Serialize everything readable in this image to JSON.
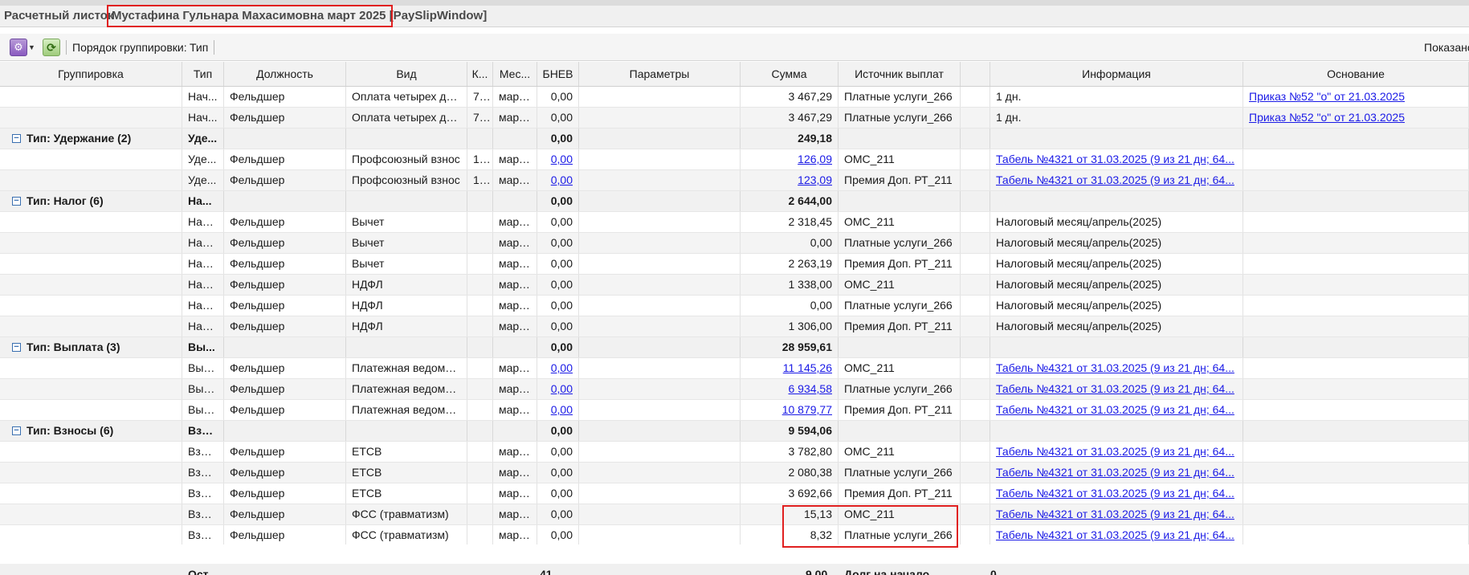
{
  "window": {
    "title_prefix": "Расчетный листок",
    "title_name": "Мустафина Гульнара Махасимовна март 2025 [PaySlipWindow]"
  },
  "toolbar": {
    "grouping_label": "Порядок группировки:",
    "grouping_value": "Тип",
    "right_label": "Показано"
  },
  "columns": [
    "Группировка",
    "Тип",
    "Должность",
    "Вид",
    "К...",
    "Мес...",
    "БНЕВ",
    "Параметры",
    "Сумма",
    "Источник выплат",
    "",
    "Информация",
    "Основание"
  ],
  "groups": [
    {
      "label": "",
      "rows": [
        {
          "type": "Нач...",
          "position": "Фельдшер",
          "kind": "Оплата четырех до...",
          "k": "7...",
          "month": "март...",
          "bnev": "0,00",
          "params": "",
          "sum": "3 467,29",
          "source": "Платные услуги_266",
          "info": "1 дн.",
          "basis": "Приказ №52 \"о\" от 21.03.2025"
        },
        {
          "type": "Нач...",
          "position": "Фельдшер",
          "kind": "Оплата четырех до...",
          "k": "7...",
          "month": "март...",
          "bnev": "0,00",
          "params": "",
          "sum": "3 467,29",
          "source": "Платные услуги_266",
          "info": "1 дн.",
          "basis": "Приказ №52 \"о\" от 21.03.2025"
        }
      ]
    },
    {
      "label": "Тип: Удержание (2)",
      "type": "Уде...",
      "bnev": "0,00",
      "sum": "249,18",
      "rows": [
        {
          "type": "Уде...",
          "position": "Фельдшер",
          "kind": "Профсоюзный взнос",
          "k": "1...",
          "month": "март...",
          "bnev": "0,00",
          "params": "",
          "sum": "126,09",
          "source": "ОМС_211",
          "info": "Табель №4321 от 31.03.2025 (9 из 21 дн; 64...",
          "basis": ""
        },
        {
          "type": "Уде...",
          "position": "Фельдшер",
          "kind": "Профсоюзный взнос",
          "k": "1...",
          "month": "март...",
          "bnev": "0,00",
          "params": "",
          "sum": "123,09",
          "source": "Премия Доп. РТ_211",
          "info": "Табель №4321 от 31.03.2025 (9 из 21 дн; 64...",
          "basis": ""
        }
      ]
    },
    {
      "label": "Тип: Налог (6)",
      "type": "На...",
      "bnev": "0,00",
      "sum": "2 644,00",
      "rows": [
        {
          "type": "Налог",
          "position": "Фельдшер",
          "kind": "Вычет",
          "k": "",
          "month": "март...",
          "bnev": "0,00",
          "params": "",
          "sum": "2 318,45",
          "source": "ОМС_211",
          "info": "Налоговый месяц/апрель(2025)",
          "basis": ""
        },
        {
          "type": "Налог",
          "position": "Фельдшер",
          "kind": "Вычет",
          "k": "",
          "month": "март...",
          "bnev": "0,00",
          "params": "",
          "sum": "0,00",
          "source": "Платные услуги_266",
          "info": "Налоговый месяц/апрель(2025)",
          "basis": ""
        },
        {
          "type": "Налог",
          "position": "Фельдшер",
          "kind": "Вычет",
          "k": "",
          "month": "март...",
          "bnev": "0,00",
          "params": "",
          "sum": "2 263,19",
          "source": "Премия Доп. РТ_211",
          "info": "Налоговый месяц/апрель(2025)",
          "basis": ""
        },
        {
          "type": "Налог",
          "position": "Фельдшер",
          "kind": "НДФЛ",
          "k": "",
          "month": "март...",
          "bnev": "0,00",
          "params": "",
          "sum": "1 338,00",
          "source": "ОМС_211",
          "info": "Налоговый месяц/апрель(2025)",
          "basis": ""
        },
        {
          "type": "Налог",
          "position": "Фельдшер",
          "kind": "НДФЛ",
          "k": "",
          "month": "март...",
          "bnev": "0,00",
          "params": "",
          "sum": "0,00",
          "source": "Платные услуги_266",
          "info": "Налоговый месяц/апрель(2025)",
          "basis": ""
        },
        {
          "type": "Налог",
          "position": "Фельдшер",
          "kind": "НДФЛ",
          "k": "",
          "month": "март...",
          "bnev": "0,00",
          "params": "",
          "sum": "1 306,00",
          "source": "Премия Доп. РТ_211",
          "info": "Налоговый месяц/апрель(2025)",
          "basis": ""
        }
      ]
    },
    {
      "label": "Тип: Выплата (3)",
      "type": "Вы...",
      "bnev": "0,00",
      "sum": "28 959,61",
      "rows": [
        {
          "type": "Вып...",
          "position": "Фельдшер",
          "kind": "Платежная ведомос...",
          "k": "",
          "month": "март...",
          "bnev": "0,00",
          "params": "",
          "sum": "11 145,26",
          "source": "ОМС_211",
          "info": "Табель №4321 от 31.03.2025 (9 из 21 дн; 64...",
          "basis": ""
        },
        {
          "type": "Вып...",
          "position": "Фельдшер",
          "kind": "Платежная ведомос...",
          "k": "",
          "month": "март...",
          "bnev": "0,00",
          "params": "",
          "sum": "6 934,58",
          "source": "Платные услуги_266",
          "info": "Табель №4321 от 31.03.2025 (9 из 21 дн; 64...",
          "basis": ""
        },
        {
          "type": "Вып...",
          "position": "Фельдшер",
          "kind": "Платежная ведомос...",
          "k": "",
          "month": "март...",
          "bnev": "0,00",
          "params": "",
          "sum": "10 879,77",
          "source": "Премия Доп. РТ_211",
          "info": "Табель №4321 от 31.03.2025 (9 из 21 дн; 64...",
          "basis": ""
        }
      ]
    },
    {
      "label": "Тип: Взносы (6)",
      "type": "Взн...",
      "bnev": "0,00",
      "sum": "9 594,06",
      "rows": [
        {
          "type": "Взно...",
          "position": "Фельдшер",
          "kind": "ЕТСВ",
          "k": "",
          "month": "март...",
          "bnev": "0,00",
          "params": "",
          "sum": "3 782,80",
          "source": "ОМС_211",
          "info": "Табель №4321 от 31.03.2025 (9 из 21 дн; 64...",
          "basis": ""
        },
        {
          "type": "Взно...",
          "position": "Фельдшер",
          "kind": "ЕТСВ",
          "k": "",
          "month": "март...",
          "bnev": "0,00",
          "params": "",
          "sum": "2 080,38",
          "source": "Платные услуги_266",
          "info": "Табель №4321 от 31.03.2025 (9 из 21 дн; 64...",
          "basis": ""
        },
        {
          "type": "Взно...",
          "position": "Фельдшер",
          "kind": "ЕТСВ",
          "k": "",
          "month": "март...",
          "bnev": "0,00",
          "params": "",
          "sum": "3 692,66",
          "source": "Премия Доп. РТ_211",
          "info": "Табель №4321 от 31.03.2025 (9 из 21 дн; 64...",
          "basis": ""
        },
        {
          "type": "Взно...",
          "position": "Фельдшер",
          "kind": "ФСС (травматизм)",
          "k": "",
          "month": "март...",
          "bnev": "0,00",
          "params": "",
          "sum": "15,13",
          "source": "ОМС_211",
          "info": "Табель №4321 от 31.03.2025 (9 из 21 дн; 64...",
          "basis": ""
        },
        {
          "type": "Взно...",
          "position": "Фельдшер",
          "kind": "ФСС (травматизм)",
          "k": "",
          "month": "март...",
          "bnev": "0,00",
          "params": "",
          "sum": "8,32",
          "source": "Платные услуги_266",
          "info": "Табель №4321 от 31.03.2025 (9 из 21 дн; 64...",
          "basis": ""
        }
      ]
    }
  ],
  "summary_row": {
    "type": "Ост...",
    "bnev": "41",
    "sum": "9 00",
    "source": "Долг на начало",
    "info": "0"
  }
}
